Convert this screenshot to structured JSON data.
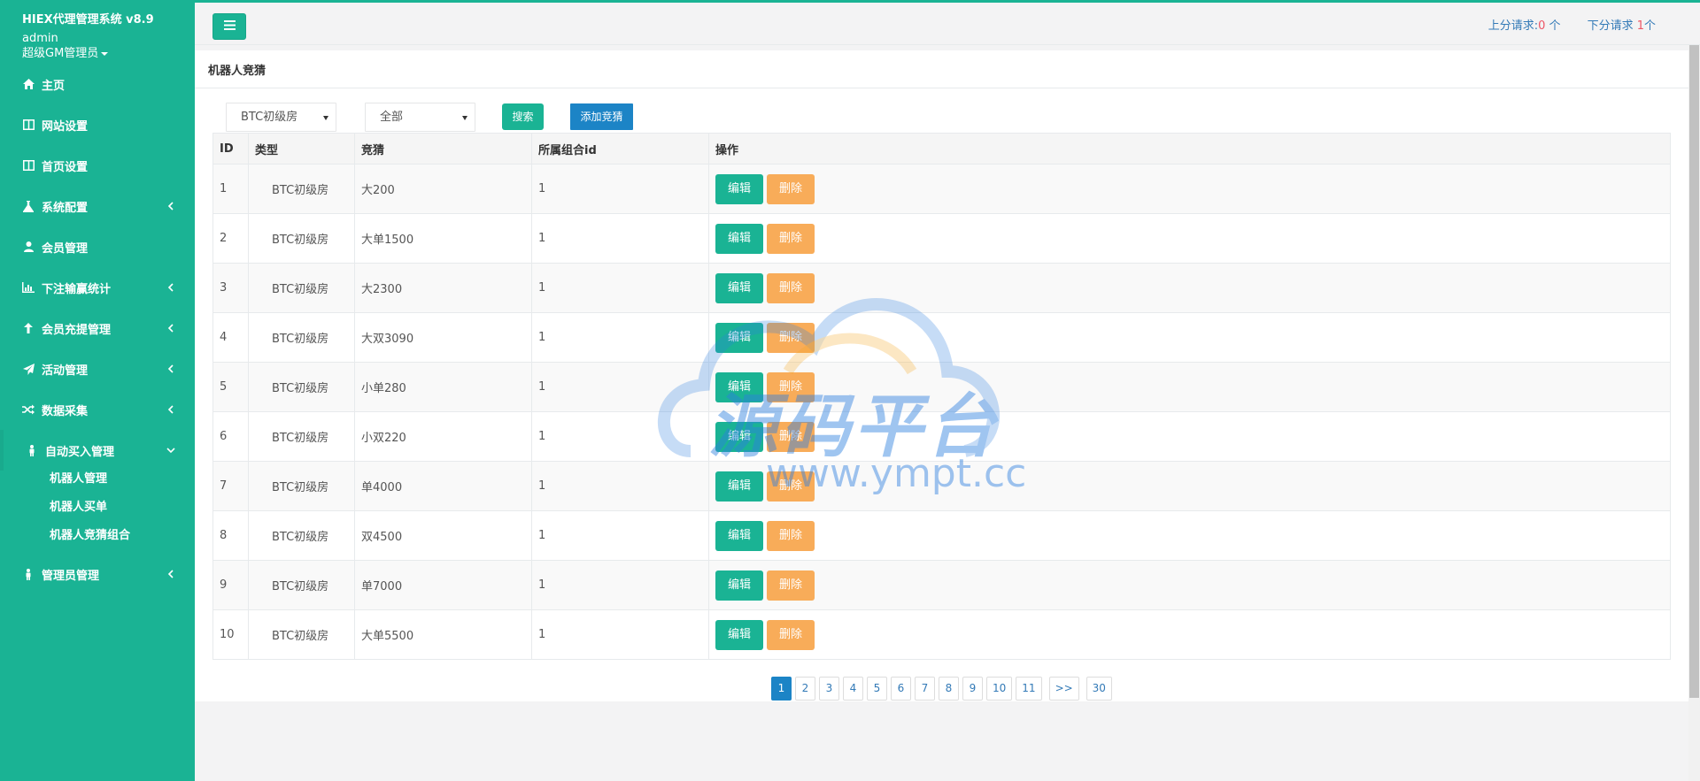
{
  "sidebar": {
    "app_title": "HIEX代理管理系统 v8.9",
    "user": "admin",
    "role": "超级GM管理员",
    "items": [
      {
        "label": "主页"
      },
      {
        "label": "网站设置"
      },
      {
        "label": "首页设置"
      },
      {
        "label": "系统配置"
      },
      {
        "label": "会员管理"
      },
      {
        "label": "下注输赢统计"
      },
      {
        "label": "会员充提管理"
      },
      {
        "label": "活动管理"
      },
      {
        "label": "数据采集"
      },
      {
        "label": "自动买入管理"
      },
      {
        "label": "管理员管理"
      }
    ],
    "subitems": [
      {
        "label": "机器人管理"
      },
      {
        "label": "机器人买单"
      },
      {
        "label": "机器人竞猜组合"
      }
    ]
  },
  "topbar": {
    "up_label": "上分请求:",
    "up_count": "0",
    "up_unit": " 个",
    "down_label": "下分请求 ",
    "down_count": "1",
    "down_unit": "个"
  },
  "page": {
    "title": "机器人竞猜",
    "room_select": "BTC初级房",
    "status_select": "全部",
    "search_label": "搜索",
    "add_label": "添加竞猜"
  },
  "table": {
    "headers": [
      "ID",
      "类型",
      "竞猜",
      "所属组合id",
      "操作"
    ],
    "edit_label": "编辑",
    "delete_label": "删除",
    "rows": [
      {
        "id": "1",
        "type": "BTC初级房",
        "guess": "大200",
        "group": "1"
      },
      {
        "id": "2",
        "type": "BTC初级房",
        "guess": "大单1500",
        "group": "1"
      },
      {
        "id": "3",
        "type": "BTC初级房",
        "guess": "大2300",
        "group": "1"
      },
      {
        "id": "4",
        "type": "BTC初级房",
        "guess": "大双3090",
        "group": "1"
      },
      {
        "id": "5",
        "type": "BTC初级房",
        "guess": "小单280",
        "group": "1"
      },
      {
        "id": "6",
        "type": "BTC初级房",
        "guess": "小双220",
        "group": "1"
      },
      {
        "id": "7",
        "type": "BTC初级房",
        "guess": "单4000",
        "group": "1"
      },
      {
        "id": "8",
        "type": "BTC初级房",
        "guess": "双4500",
        "group": "1"
      },
      {
        "id": "9",
        "type": "BTC初级房",
        "guess": "单7000",
        "group": "1"
      },
      {
        "id": "10",
        "type": "BTC初级房",
        "guess": "大单5500",
        "group": "1"
      }
    ]
  },
  "pagination": {
    "pages": [
      "1",
      "2",
      "3",
      "4",
      "5",
      "6",
      "7",
      "8",
      "9",
      "10",
      "11"
    ],
    "next": ">>",
    "last": "30",
    "current": "1"
  },
  "watermark": {
    "title": "源码平台",
    "url": "www.ympt.cc"
  }
}
